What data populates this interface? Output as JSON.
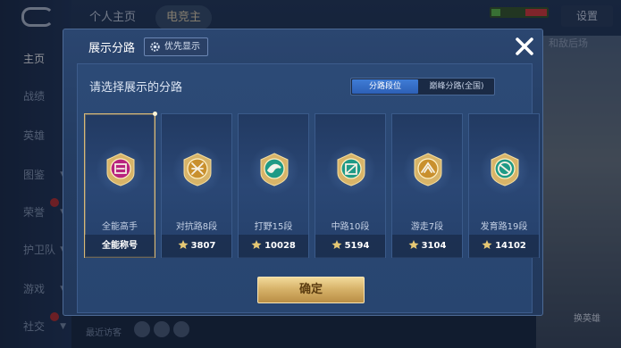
{
  "background": {
    "sidebar": [
      {
        "label": "主页",
        "active": true
      },
      {
        "label": "战绩"
      },
      {
        "label": "英雄"
      },
      {
        "label": "图鉴"
      },
      {
        "label": "荣誉"
      },
      {
        "label": "护卫队"
      },
      {
        "label": "游戏"
      },
      {
        "label": "社交"
      }
    ],
    "tabs": [
      "个人主页",
      "电竞主"
    ],
    "settings_label": "设置",
    "right_faint_text": "和敌后场",
    "change_hero_label": "换英雄",
    "visitors_label": "最近访客"
  },
  "modal": {
    "title": "展示分路",
    "priority_button": "优先显示",
    "prompt": "请选择展示的分路",
    "segments": [
      {
        "label": "分路段位",
        "active": true
      },
      {
        "label": "巅峰分路(全国)",
        "active": false
      }
    ],
    "cards": [
      {
        "name": "全能高手",
        "value": "全能称号",
        "icon": "all-round-badge-icon",
        "selected": true,
        "color": "#b8237e",
        "has_star": false
      },
      {
        "name": "对抗路8段",
        "value": "3807",
        "icon": "clash-lane-badge-icon",
        "selected": false,
        "color": "#c9902e",
        "has_star": true
      },
      {
        "name": "打野15段",
        "value": "10028",
        "icon": "jungle-badge-icon",
        "selected": false,
        "color": "#1f9a86",
        "has_star": true
      },
      {
        "name": "中路10段",
        "value": "5194",
        "icon": "mid-lane-badge-icon",
        "selected": false,
        "color": "#1f9a86",
        "has_star": true
      },
      {
        "name": "游走7段",
        "value": "3104",
        "icon": "roam-badge-icon",
        "selected": false,
        "color": "#c9902e",
        "has_star": true
      },
      {
        "name": "发育路19段",
        "value": "14102",
        "icon": "farm-lane-badge-icon",
        "selected": false,
        "color": "#1f9a86",
        "has_star": true
      }
    ],
    "confirm_label": "确定"
  }
}
